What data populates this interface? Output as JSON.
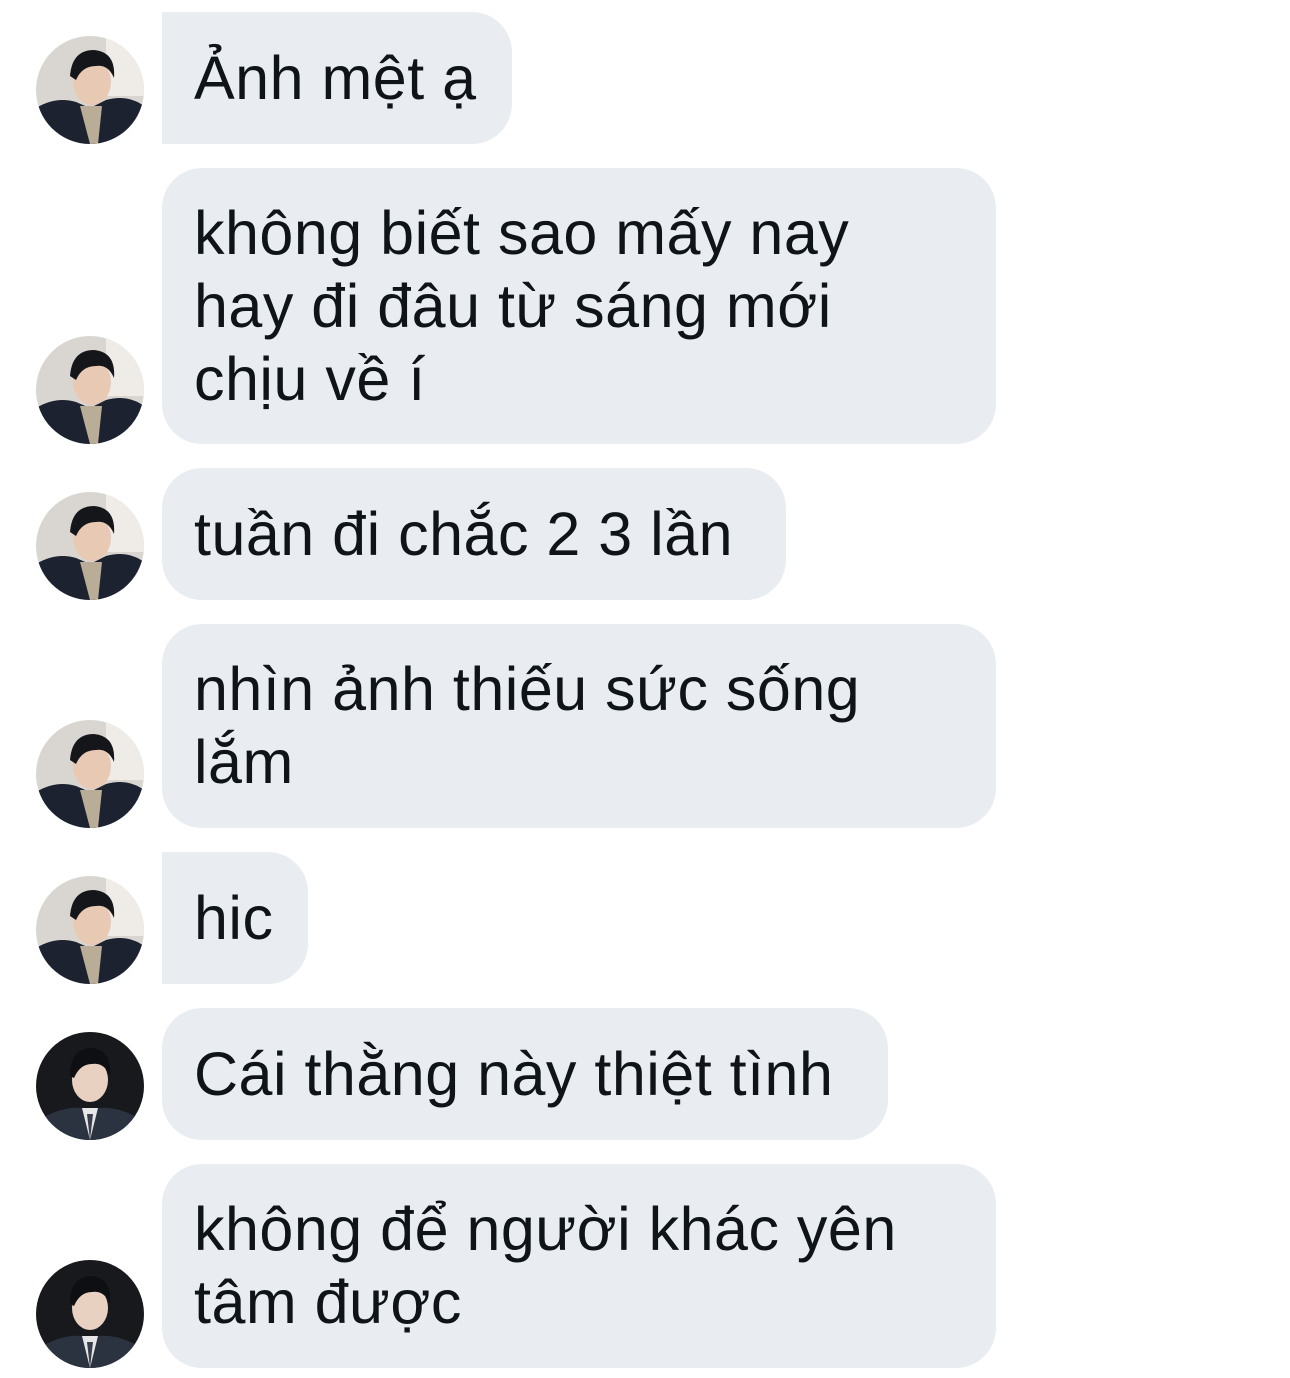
{
  "conversation": {
    "messages": [
      {
        "sender": "person-a",
        "text": "Ảnh mệt ạ"
      },
      {
        "sender": "person-a",
        "text": "không biết sao mấy nay\nhay đi đâu từ sáng mới\nchịu về í"
      },
      {
        "sender": "person-a",
        "text": "tuần đi chắc 2 3 lần"
      },
      {
        "sender": "person-a",
        "text": "nhìn ảnh thiếu sức sống\nlắm"
      },
      {
        "sender": "person-a",
        "text": "hic"
      },
      {
        "sender": "person-b",
        "text": "Cái thằng này thiệt tình"
      },
      {
        "sender": "person-b",
        "text": "không để người khác yên\ntâm được"
      }
    ]
  },
  "colors": {
    "bubble_background": "#e9edf1",
    "text": "#0f1419",
    "page_background": "#ffffff"
  }
}
